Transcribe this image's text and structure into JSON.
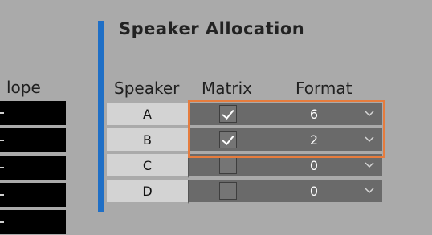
{
  "left_panel": {
    "header_partial": "lope",
    "rows": 5
  },
  "panel": {
    "title": "Speaker Allocation",
    "accent_color": "#1f6fc6",
    "highlight_color": "#e67c3d",
    "columns": {
      "speaker": "Speaker",
      "matrix": "Matrix",
      "format": "Format"
    },
    "rows": [
      {
        "speaker": "A",
        "matrix_checked": true,
        "format": "6"
      },
      {
        "speaker": "B",
        "matrix_checked": true,
        "format": "2"
      },
      {
        "speaker": "C",
        "matrix_checked": false,
        "format": "0"
      },
      {
        "speaker": "D",
        "matrix_checked": false,
        "format": "0"
      }
    ]
  }
}
